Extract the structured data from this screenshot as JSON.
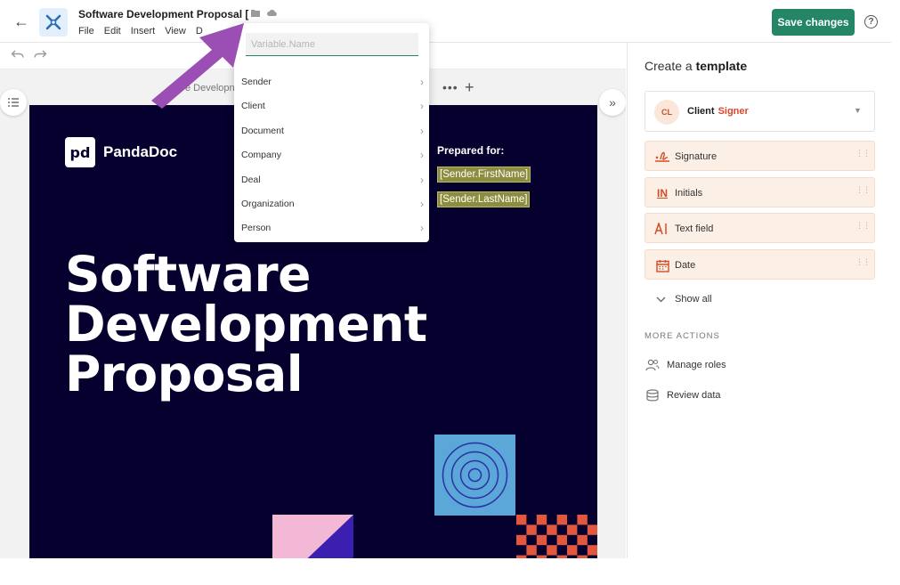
{
  "header": {
    "doc_title": "Software Development Proposal [",
    "menu": [
      "File",
      "Edit",
      "Insert",
      "View",
      "D"
    ],
    "save_label": "Save changes",
    "help_glyph": "?"
  },
  "editor": {
    "page_tab_label": "e Developn",
    "more_glyph": "•••",
    "add_glyph": "+",
    "expand_glyph": "»"
  },
  "document": {
    "logo_mark": "pd",
    "logo_text": "PandaDoc",
    "prepared_for": "Prepared for:",
    "variables": [
      "[Sender.FirstName]",
      "[Sender.LastName]"
    ],
    "title_lines": [
      "Software",
      "Development",
      "Proposal"
    ]
  },
  "dropdown": {
    "placeholder": "Variable.Name",
    "items": [
      "Sender",
      "Client",
      "Document",
      "Company",
      "Deal",
      "Organization",
      "Person"
    ]
  },
  "panel": {
    "title_prefix": "Create a",
    "title_bold": "template",
    "role": {
      "initials": "CL",
      "name": "Client",
      "type": "Signer"
    },
    "fields": [
      {
        "label": "Signature",
        "icon": "signature-icon"
      },
      {
        "label": "Initials",
        "icon": "initials-icon"
      },
      {
        "label": "Text field",
        "icon": "text-field-icon"
      },
      {
        "label": "Date",
        "icon": "calendar-icon"
      }
    ],
    "initials_glyph": "IN",
    "show_all": "Show all",
    "more_actions": "MORE ACTIONS",
    "actions": [
      {
        "label": "Manage roles",
        "icon": "users-icon"
      },
      {
        "label": "Review data",
        "icon": "database-icon"
      }
    ]
  },
  "colors": {
    "brand_green": "#248567",
    "page_bg": "#05002e",
    "signer_red": "#d9472b",
    "arrow_purple": "#9b4fb4",
    "field_bg": "#fcefe6"
  }
}
